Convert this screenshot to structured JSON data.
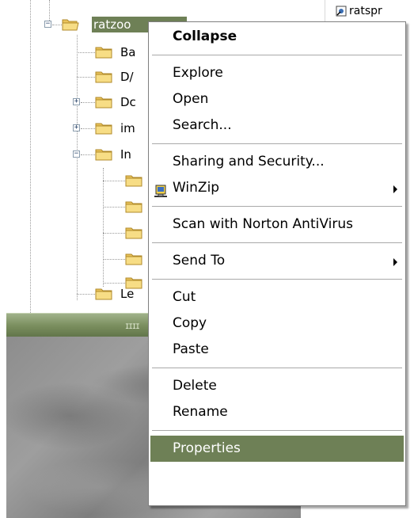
{
  "tree": {
    "selected_label": "ratzoo",
    "nodes": [
      {
        "label": "Ba",
        "expander": ""
      },
      {
        "label": "D/",
        "expander": ""
      },
      {
        "label": "Dc",
        "expander": "+"
      },
      {
        "label": "im",
        "expander": "+"
      },
      {
        "label": "In",
        "expander": "−"
      },
      {
        "label": "",
        "expander": ""
      },
      {
        "label": "",
        "expander": ""
      },
      {
        "label": "",
        "expander": ""
      },
      {
        "label": "",
        "expander": ""
      },
      {
        "label": "",
        "expander": ""
      },
      {
        "label": "Le",
        "expander": ""
      }
    ],
    "root_expander": "−"
  },
  "right_pane": {
    "item_label": "ratspr"
  },
  "splitter": {
    "grip": "IIII"
  },
  "context_menu": {
    "groups": [
      [
        {
          "label": "Collapse",
          "bold": true
        }
      ],
      [
        {
          "label": "Explore"
        },
        {
          "label": "Open"
        },
        {
          "label": "Search..."
        }
      ],
      [
        {
          "label": "Sharing and Security..."
        },
        {
          "label": "WinZip",
          "submenu": true,
          "icon": "winzip-icon"
        }
      ],
      [
        {
          "label": "Scan with Norton AntiVirus"
        }
      ],
      [
        {
          "label": "Send To",
          "submenu": true
        }
      ],
      [
        {
          "label": "Cut"
        },
        {
          "label": "Copy"
        },
        {
          "label": "Paste"
        }
      ],
      [
        {
          "label": "Delete"
        },
        {
          "label": "Rename"
        }
      ],
      [
        {
          "label": "Properties",
          "highlighted": true
        }
      ]
    ]
  },
  "colors": {
    "selection": "#6e8056",
    "folder": "#f3d77b"
  }
}
